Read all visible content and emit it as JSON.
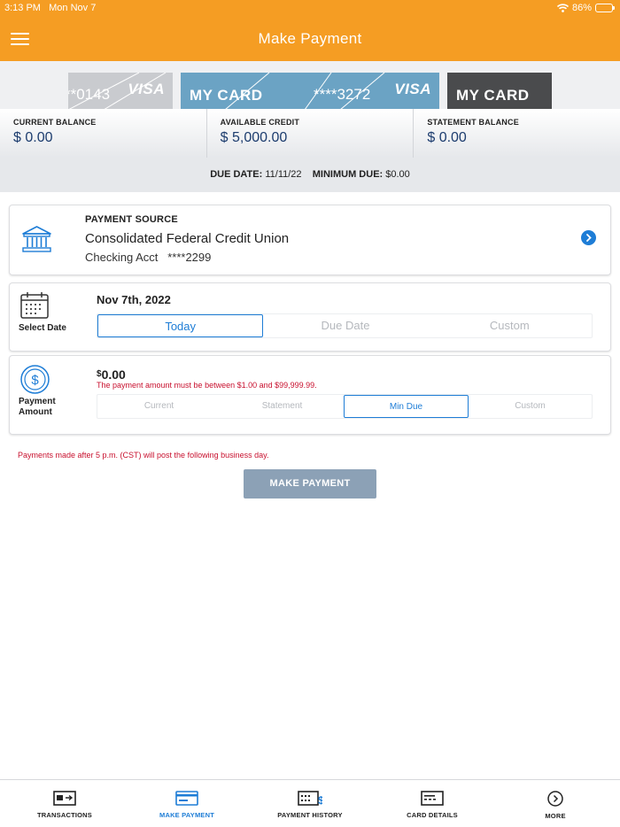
{
  "status": {
    "time": "3:13 PM",
    "date": "Mon Nov 7",
    "battery": "86%"
  },
  "header": {
    "title": "Make Payment"
  },
  "cards": [
    {
      "mask": "**0143",
      "brand": "VISA"
    },
    {
      "name": "MY CARD",
      "mask": "****3272",
      "brand": "VISA"
    },
    {
      "name": "MY CARD"
    }
  ],
  "balances": [
    {
      "label": "CURRENT BALANCE",
      "value": "$ 0.00"
    },
    {
      "label": "AVAILABLE CREDIT",
      "value": "$ 5,000.00"
    },
    {
      "label": "STATEMENT BALANCE",
      "value": "$ 0.00"
    }
  ],
  "due": {
    "due_label": "DUE DATE:",
    "due_value": "11/11/22",
    "min_label": "MINIMUM DUE:",
    "min_value": "$0.00"
  },
  "source": {
    "title": "PAYMENT SOURCE",
    "name": "Consolidated Federal Credit Union",
    "account": "Checking Acct   ****2299"
  },
  "date": {
    "label": "Select Date",
    "value": "Nov 7th, 2022",
    "options": [
      "Today",
      "Due Date",
      "Custom"
    ],
    "selected": "Today"
  },
  "amount": {
    "label_line1": "Payment",
    "label_line2": "Amount",
    "currency": "$",
    "value": "0.00",
    "error": "The payment amount must be between $1.00 and $99,999.99.",
    "options": [
      "Current",
      "Statement",
      "Min Due",
      "Custom"
    ],
    "selected": "Min Due"
  },
  "notice": "Payments made after 5 p.m. (CST) will post the following business day.",
  "make_payment_label": "MAKE PAYMENT",
  "nav": [
    {
      "label": "TRANSACTIONS",
      "icon": "transactions-icon"
    },
    {
      "label": "MAKE PAYMENT",
      "icon": "make-payment-icon"
    },
    {
      "label": "PAYMENT HISTORY",
      "icon": "payment-history-icon"
    },
    {
      "label": "CARD DETAILS",
      "icon": "card-details-icon"
    },
    {
      "label": "MORE",
      "icon": "more-icon"
    }
  ],
  "colors": {
    "brand": "#f59d23",
    "accent": "#1e7dd6",
    "error": "#c8102e",
    "balance_text": "#1c3c6e"
  }
}
